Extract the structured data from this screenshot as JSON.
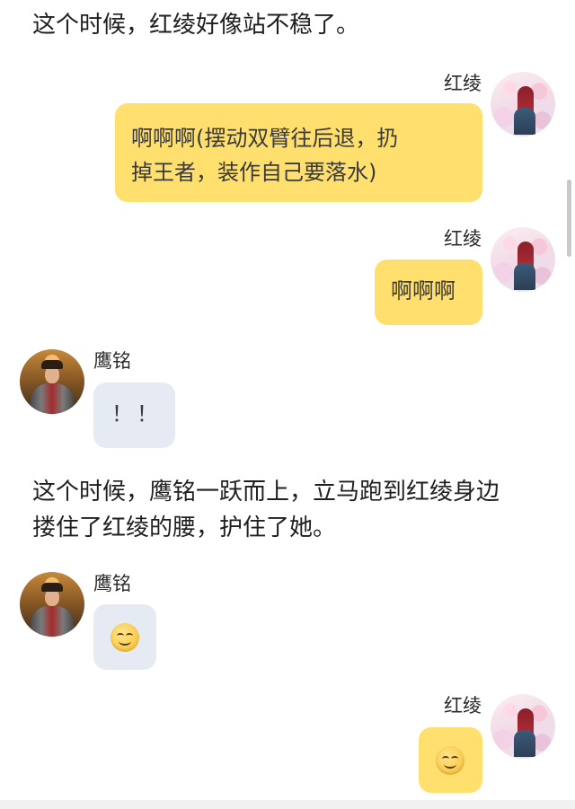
{
  "characters": {
    "hongling": {
      "name": "红绫"
    },
    "yingming": {
      "name": "鹰铭"
    }
  },
  "narration": [
    "这个时候，红绫好像站不稳了。",
    "这个时候，鹰铭一跃而上，立马跑到红绫身边\n搂住了红绫的腰，护住了她。"
  ],
  "messages": [
    {
      "sender": "红绫",
      "side": "right",
      "text": "啊啊啊(摆动双臂往后退，扔\n掉王者，装作自己要落水)"
    },
    {
      "sender": "红绫",
      "side": "right",
      "text": "啊啊啊"
    },
    {
      "sender": "鹰铭",
      "side": "left",
      "text": "！！"
    },
    {
      "sender": "鹰铭",
      "side": "left",
      "icon": "smile-emoji"
    },
    {
      "sender": "红绫",
      "side": "right",
      "icon": "smile-emoji"
    }
  ],
  "colors": {
    "self_bubble": "#ffdf6e",
    "other_bubble": "#e6ebf3",
    "background": "#ffffff"
  }
}
